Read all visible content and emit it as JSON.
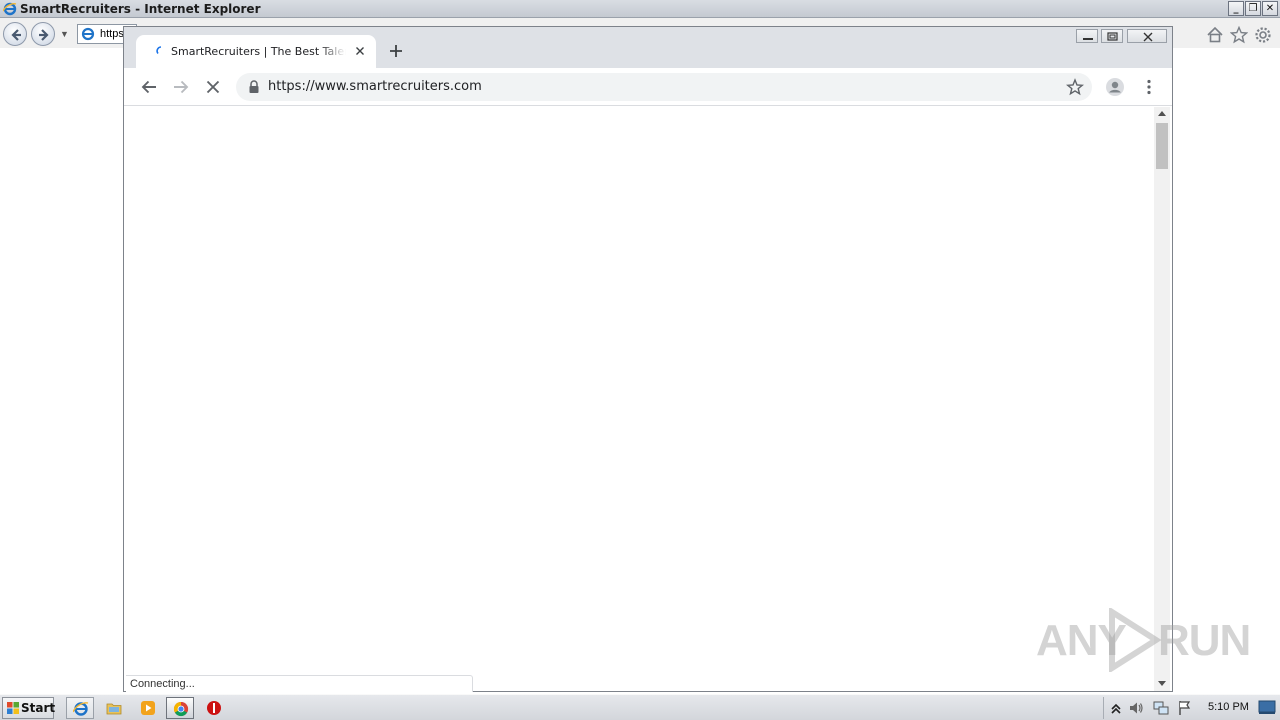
{
  "ie_window": {
    "title": "SmartRecruiters - Internet Explorer",
    "address_partial": "https:"
  },
  "chrome": {
    "tab_title": "SmartRecruiters | The Best Talent Acquisition Suite",
    "url": "https://www.smartrecruiters.com",
    "status": "Connecting...",
    "colors": {
      "tabstrip": "#dee1e6",
      "omnibox": "#f1f3f4",
      "favicon_accent": "#1a73e8"
    }
  },
  "watermark": {
    "left": "ANY",
    "right": "RUN"
  },
  "taskbar": {
    "start_label": "Start",
    "clock": "5:10 PM",
    "apps": [
      "ie-icon",
      "explorer-icon",
      "media-player-icon",
      "chrome-icon",
      "stop-icon"
    ]
  }
}
